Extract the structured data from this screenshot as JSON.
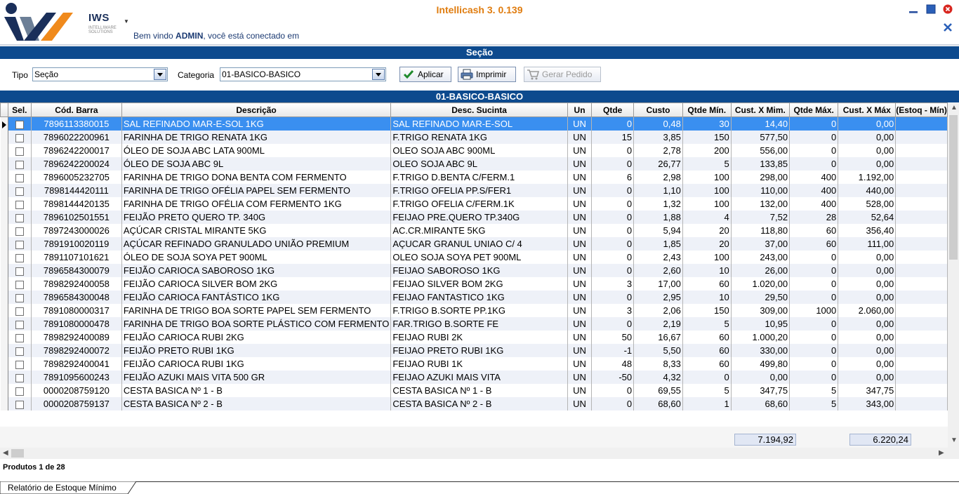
{
  "app": {
    "title": "Intellicash 3. 0.139",
    "brand": "IWS",
    "brand_sub": "INTELLIWARE SOLUTIONS",
    "welcome_prefix": "Bem vindo ",
    "user": "ADMIN",
    "welcome_suffix": ", você está conectado em"
  },
  "section": {
    "title": "Seção"
  },
  "filters": {
    "tipo_label": "Tipo",
    "tipo_value": "Seção",
    "categoria_label": "Categoria",
    "categoria_value": "01-BASICO-BASICO",
    "apply_label": "Aplicar",
    "print_label": "Imprimir",
    "order_label": "Gerar Pedido"
  },
  "group": {
    "title": "01-BASICO-BASICO"
  },
  "grid": {
    "columns": [
      "Sel.",
      "Cód. Barra",
      "Descrição",
      "Desc. Sucinta",
      "Un",
      "Qtde",
      "Custo",
      "Qtde Mín.",
      "Cust. X Mim.",
      "Qtde Máx.",
      "Cust. X Máx",
      "(Estoq - Mín)"
    ],
    "rows": [
      {
        "barcode": "7896113380015",
        "desc": "SAL REFINADO MAR-E-SOL 1KG",
        "short": "SAL REFINADO MAR-E-SOL",
        "un": "UN",
        "qtde": "0",
        "custo": "0,48",
        "qmin": "30",
        "cmin": "14,40",
        "qmax": "0",
        "cmax": "0,00"
      },
      {
        "barcode": "7896022200961",
        "desc": "FARINHA DE TRIGO RENATA 1KG",
        "short": "F.TRIGO RENATA 1KG",
        "un": "UN",
        "qtde": "15",
        "custo": "3,85",
        "qmin": "150",
        "cmin": "577,50",
        "qmax": "0",
        "cmax": "0,00"
      },
      {
        "barcode": "7896242200017",
        "desc": "ÓLEO DE SOJA ABC LATA 900ML",
        "short": "OLEO SOJA ABC 900ML",
        "un": "UN",
        "qtde": "0",
        "custo": "2,78",
        "qmin": "200",
        "cmin": "556,00",
        "qmax": "0",
        "cmax": "0,00"
      },
      {
        "barcode": "7896242200024",
        "desc": "ÓLEO DE SOJA ABC 9L",
        "short": "OLEO SOJA ABC 9L",
        "un": "UN",
        "qtde": "0",
        "custo": "26,77",
        "qmin": "5",
        "cmin": "133,85",
        "qmax": "0",
        "cmax": "0,00"
      },
      {
        "barcode": "7896005232705",
        "desc": "FARINHA DE TRIGO DONA BENTA COM FERMENTO",
        "short": "F.TRIGO D.BENTA C/FERM.1",
        "un": "UN",
        "qtde": "6",
        "custo": "2,98",
        "qmin": "100",
        "cmin": "298,00",
        "qmax": "400",
        "cmax": "1.192,00"
      },
      {
        "barcode": "7898144420111",
        "desc": "FARINHA DE TRIGO OFÉLIA PAPEL SEM FERMENTO",
        "short": "F.TRIGO OFELIA PP.S/FER1",
        "un": "UN",
        "qtde": "0",
        "custo": "1,10",
        "qmin": "100",
        "cmin": "110,00",
        "qmax": "400",
        "cmax": "440,00"
      },
      {
        "barcode": "7898144420135",
        "desc": "FARINHA DE TRIGO OFÉLIA COM FERMENTO 1KG",
        "short": "F.TRIGO OFELIA C/FERM.1K",
        "un": "UN",
        "qtde": "0",
        "custo": "1,32",
        "qmin": "100",
        "cmin": "132,00",
        "qmax": "400",
        "cmax": "528,00"
      },
      {
        "barcode": "7896102501551",
        "desc": "FEIJÃO PRETO QUERO TP. 340G",
        "short": "FEIJAO PRE.QUERO TP.340G",
        "un": "UN",
        "qtde": "0",
        "custo": "1,88",
        "qmin": "4",
        "cmin": "7,52",
        "qmax": "28",
        "cmax": "52,64"
      },
      {
        "barcode": "7897243000026",
        "desc": "AÇÚCAR CRISTAL MIRANTE 5KG",
        "short": "AC.CR.MIRANTE 5KG",
        "un": "UN",
        "qtde": "0",
        "custo": "5,94",
        "qmin": "20",
        "cmin": "118,80",
        "qmax": "60",
        "cmax": "356,40"
      },
      {
        "barcode": "7891910020119",
        "desc": "AÇÚCAR REFINADO GRANULADO UNIÃO PREMIUM",
        "short": "AÇUCAR GRANUL UNIAO C/ 4",
        "un": "UN",
        "qtde": "0",
        "custo": "1,85",
        "qmin": "20",
        "cmin": "37,00",
        "qmax": "60",
        "cmax": "111,00"
      },
      {
        "barcode": "7891107101621",
        "desc": "ÓLEO DE SOJA SOYA PET 900ML",
        "short": "OLEO SOJA SOYA PET 900ML",
        "un": "UN",
        "qtde": "0",
        "custo": "2,43",
        "qmin": "100",
        "cmin": "243,00",
        "qmax": "0",
        "cmax": "0,00"
      },
      {
        "barcode": "7896584300079",
        "desc": "FEIJÃO CARIOCA SABOROSO 1KG",
        "short": "FEIJAO SABOROSO 1KG",
        "un": "UN",
        "qtde": "0",
        "custo": "2,60",
        "qmin": "10",
        "cmin": "26,00",
        "qmax": "0",
        "cmax": "0,00"
      },
      {
        "barcode": "7898292400058",
        "desc": "FEIJÃO CARIOCA SILVER BOM 2KG",
        "short": "FEIJAO SILVER BOM 2KG",
        "un": "UN",
        "qtde": "3",
        "custo": "17,00",
        "qmin": "60",
        "cmin": "1.020,00",
        "qmax": "0",
        "cmax": "0,00"
      },
      {
        "barcode": "7896584300048",
        "desc": "FEIJÃO CARIOCA FANTÁSTICO 1KG",
        "short": "FEIJAO FANTASTICO 1KG",
        "un": "UN",
        "qtde": "0",
        "custo": "2,95",
        "qmin": "10",
        "cmin": "29,50",
        "qmax": "0",
        "cmax": "0,00"
      },
      {
        "barcode": "7891080000317",
        "desc": "FARINHA DE TRIGO BOA SORTE PAPEL SEM FERMENTO",
        "short": "F.TRIGO B.SORTE PP.1KG",
        "un": "UN",
        "qtde": "3",
        "custo": "2,06",
        "qmin": "150",
        "cmin": "309,00",
        "qmax": "1000",
        "cmax": "2.060,00"
      },
      {
        "barcode": "7891080000478",
        "desc": "FARINHA DE TRIGO BOA SORTE PLÁSTICO COM FERMENTO",
        "short": "FAR.TRIGO B.SORTE FE",
        "un": "UN",
        "qtde": "0",
        "custo": "2,19",
        "qmin": "5",
        "cmin": "10,95",
        "qmax": "0",
        "cmax": "0,00"
      },
      {
        "barcode": "7898292400089",
        "desc": "FEIJÃO CARIOCA RUBI 2KG",
        "short": "FEIJAO RUBI 2K",
        "un": "UN",
        "qtde": "50",
        "custo": "16,67",
        "qmin": "60",
        "cmin": "1.000,20",
        "qmax": "0",
        "cmax": "0,00"
      },
      {
        "barcode": "7898292400072",
        "desc": "FEIJÃO PRETO RUBI 1KG",
        "short": "FEIJAO PRETO RUBI 1KG",
        "un": "UN",
        "qtde": "-1",
        "custo": "5,50",
        "qmin": "60",
        "cmin": "330,00",
        "qmax": "0",
        "cmax": "0,00"
      },
      {
        "barcode": "7898292400041",
        "desc": "FEIJÃO CARIOCA RUBI 1KG",
        "short": "FEIJAO RUBI 1K",
        "un": "UN",
        "qtde": "48",
        "custo": "8,33",
        "qmin": "60",
        "cmin": "499,80",
        "qmax": "0",
        "cmax": "0,00"
      },
      {
        "barcode": "7891095600243",
        "desc": "FEIJÃO AZUKI MAIS VITA 500 GR",
        "short": "FEIJAO AZUKI MAIS VITA",
        "un": "UN",
        "qtde": "-50",
        "custo": "4,32",
        "qmin": "0",
        "cmin": "0,00",
        "qmax": "0",
        "cmax": "0,00"
      },
      {
        "barcode": "0000208759120",
        "desc": "CESTA BASICA Nº 1 - B",
        "short": "CESTA BASICA Nº 1 - B",
        "un": "UN",
        "qtde": "0",
        "custo": "69,55",
        "qmin": "5",
        "cmin": "347,75",
        "qmax": "5",
        "cmax": "347,75"
      },
      {
        "barcode": "0000208759137",
        "desc": "CESTA BASICA Nº 2 - B",
        "short": "CESTA BASICA Nº 2 - B",
        "un": "UN",
        "qtde": "0",
        "custo": "68,60",
        "qmin": "1",
        "cmin": "68,60",
        "qmax": "5",
        "cmax": "343,00"
      }
    ]
  },
  "totals": {
    "cust_min": "7.194,92",
    "cust_max": "6.220,24"
  },
  "status": {
    "text": "Produtos 1 de 28"
  },
  "tabs": [
    {
      "label": "Relatório de Estoque Mínimo"
    }
  ],
  "colors": {
    "bar_blue": "#0d4a8e",
    "title_orange": "#e07d10",
    "selection": "#3a8ff0"
  }
}
